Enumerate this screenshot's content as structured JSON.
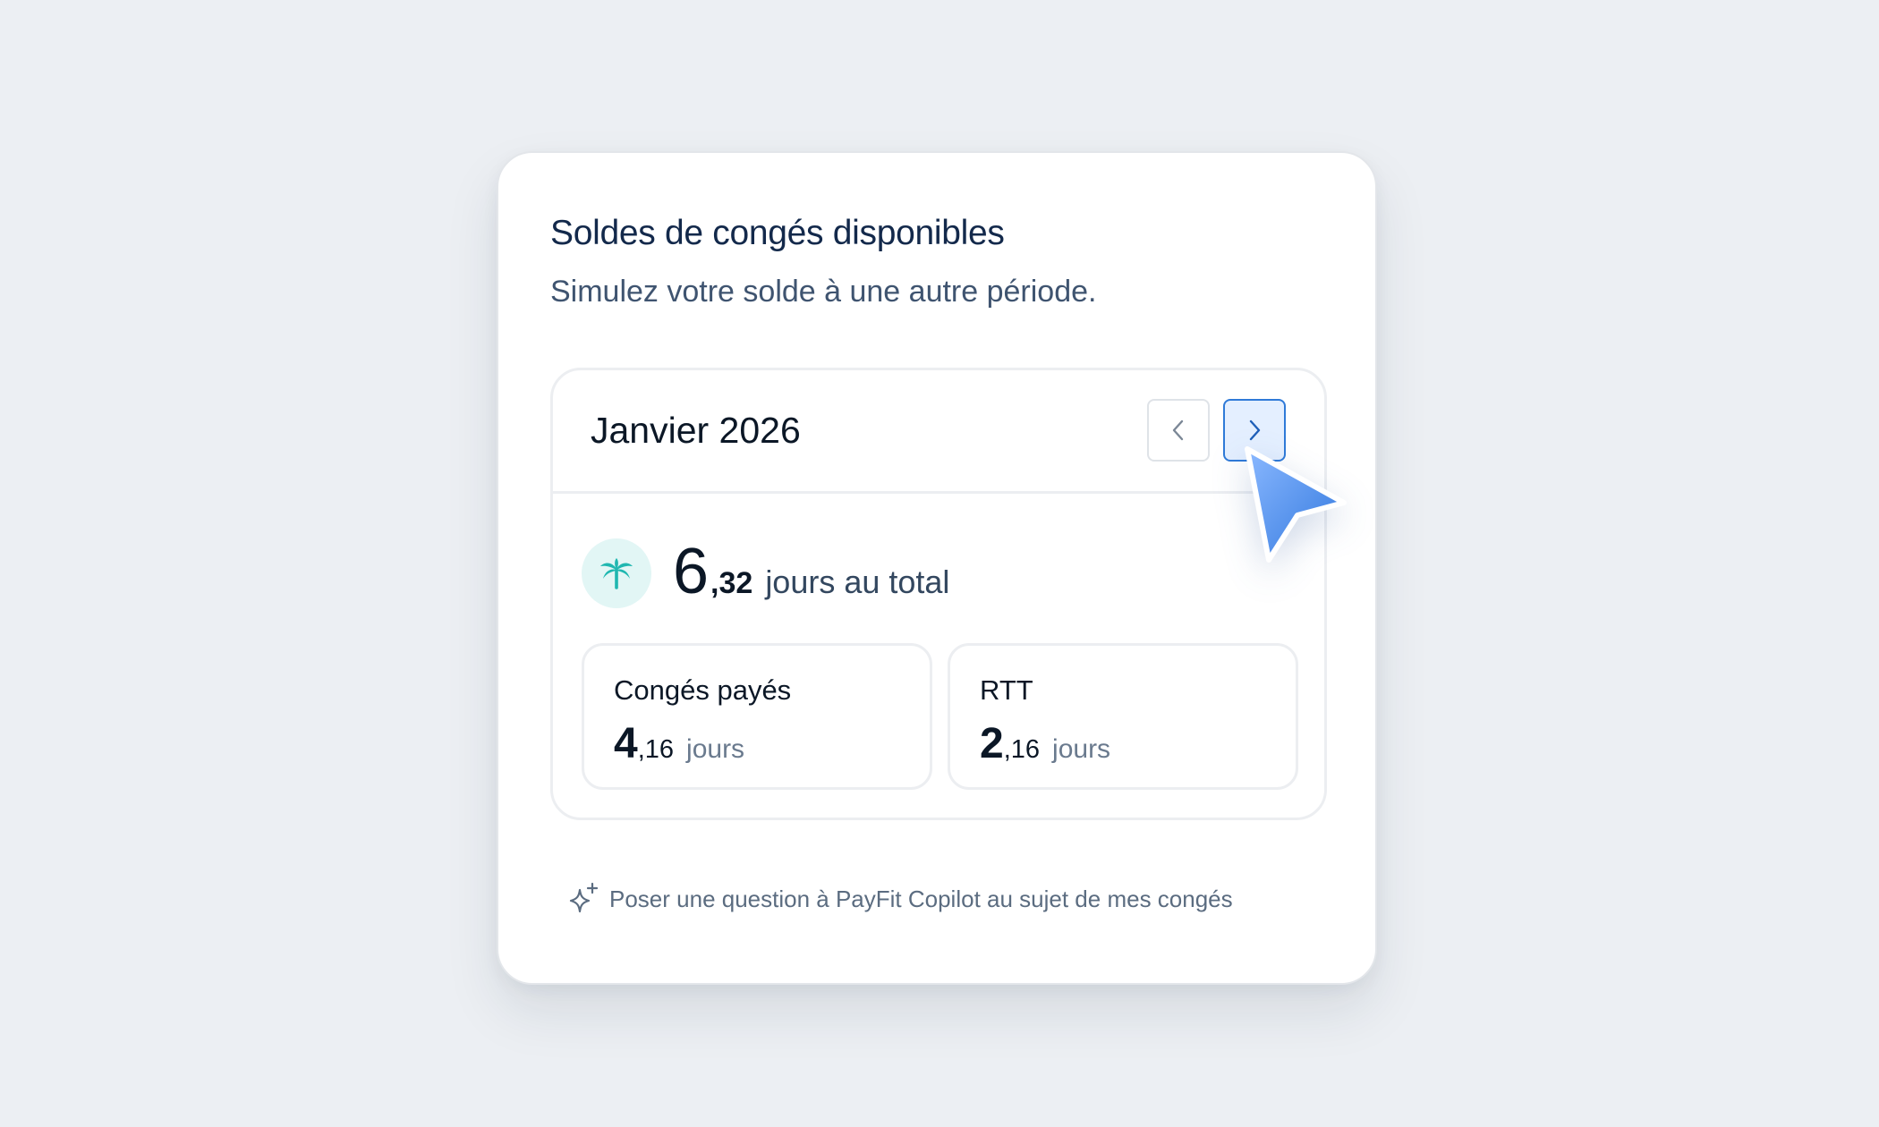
{
  "card": {
    "title": "Soldes de congés disponibles",
    "subtitle": "Simulez votre solde à une autre période."
  },
  "period": {
    "month_label": "Janvier 2026",
    "prev_icon": "chevron-left-icon",
    "next_icon": "chevron-right-icon"
  },
  "total": {
    "icon": "palm-tree-icon",
    "integer": "6",
    "decimal": ",32",
    "label": "jours au total"
  },
  "balances": [
    {
      "label": "Congés payés",
      "integer": "4",
      "decimal": ",16",
      "unit": "jours"
    },
    {
      "label": "RTT",
      "integer": "2",
      "decimal": ",16",
      "unit": "jours"
    }
  ],
  "copilot": {
    "icon": "sparkle-icon",
    "text": "Poser une question à PayFit Copilot au sujet de mes congés"
  },
  "colors": {
    "background": "#eceff3",
    "title": "#13294b",
    "accent": "#2f7ad8",
    "teal": "#1fb7b0"
  }
}
